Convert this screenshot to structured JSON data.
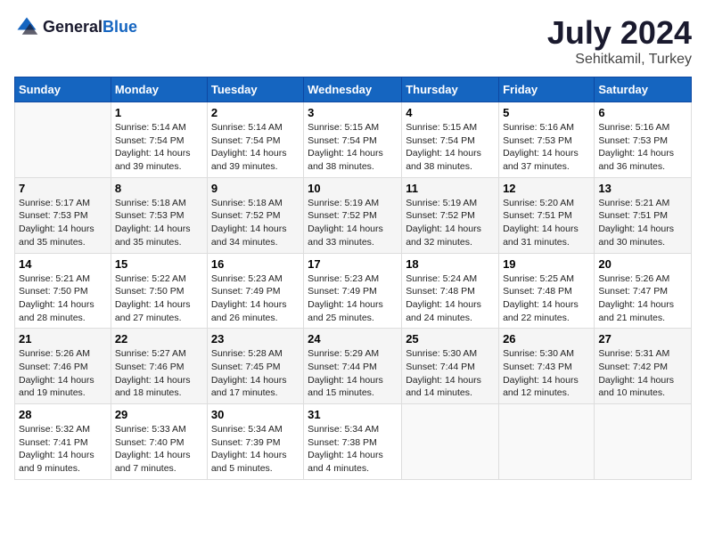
{
  "header": {
    "logo_general": "General",
    "logo_blue": "Blue",
    "month": "July 2024",
    "location": "Sehitkamil, Turkey"
  },
  "days_of_week": [
    "Sunday",
    "Monday",
    "Tuesday",
    "Wednesday",
    "Thursday",
    "Friday",
    "Saturday"
  ],
  "weeks": [
    [
      {
        "day": "",
        "sunrise": "",
        "sunset": "",
        "daylight": ""
      },
      {
        "day": "1",
        "sunrise": "Sunrise: 5:14 AM",
        "sunset": "Sunset: 7:54 PM",
        "daylight": "Daylight: 14 hours and 39 minutes."
      },
      {
        "day": "2",
        "sunrise": "Sunrise: 5:14 AM",
        "sunset": "Sunset: 7:54 PM",
        "daylight": "Daylight: 14 hours and 39 minutes."
      },
      {
        "day": "3",
        "sunrise": "Sunrise: 5:15 AM",
        "sunset": "Sunset: 7:54 PM",
        "daylight": "Daylight: 14 hours and 38 minutes."
      },
      {
        "day": "4",
        "sunrise": "Sunrise: 5:15 AM",
        "sunset": "Sunset: 7:54 PM",
        "daylight": "Daylight: 14 hours and 38 minutes."
      },
      {
        "day": "5",
        "sunrise": "Sunrise: 5:16 AM",
        "sunset": "Sunset: 7:53 PM",
        "daylight": "Daylight: 14 hours and 37 minutes."
      },
      {
        "day": "6",
        "sunrise": "Sunrise: 5:16 AM",
        "sunset": "Sunset: 7:53 PM",
        "daylight": "Daylight: 14 hours and 36 minutes."
      }
    ],
    [
      {
        "day": "7",
        "sunrise": "Sunrise: 5:17 AM",
        "sunset": "Sunset: 7:53 PM",
        "daylight": "Daylight: 14 hours and 35 minutes."
      },
      {
        "day": "8",
        "sunrise": "Sunrise: 5:18 AM",
        "sunset": "Sunset: 7:53 PM",
        "daylight": "Daylight: 14 hours and 35 minutes."
      },
      {
        "day": "9",
        "sunrise": "Sunrise: 5:18 AM",
        "sunset": "Sunset: 7:52 PM",
        "daylight": "Daylight: 14 hours and 34 minutes."
      },
      {
        "day": "10",
        "sunrise": "Sunrise: 5:19 AM",
        "sunset": "Sunset: 7:52 PM",
        "daylight": "Daylight: 14 hours and 33 minutes."
      },
      {
        "day": "11",
        "sunrise": "Sunrise: 5:19 AM",
        "sunset": "Sunset: 7:52 PM",
        "daylight": "Daylight: 14 hours and 32 minutes."
      },
      {
        "day": "12",
        "sunrise": "Sunrise: 5:20 AM",
        "sunset": "Sunset: 7:51 PM",
        "daylight": "Daylight: 14 hours and 31 minutes."
      },
      {
        "day": "13",
        "sunrise": "Sunrise: 5:21 AM",
        "sunset": "Sunset: 7:51 PM",
        "daylight": "Daylight: 14 hours and 30 minutes."
      }
    ],
    [
      {
        "day": "14",
        "sunrise": "Sunrise: 5:21 AM",
        "sunset": "Sunset: 7:50 PM",
        "daylight": "Daylight: 14 hours and 28 minutes."
      },
      {
        "day": "15",
        "sunrise": "Sunrise: 5:22 AM",
        "sunset": "Sunset: 7:50 PM",
        "daylight": "Daylight: 14 hours and 27 minutes."
      },
      {
        "day": "16",
        "sunrise": "Sunrise: 5:23 AM",
        "sunset": "Sunset: 7:49 PM",
        "daylight": "Daylight: 14 hours and 26 minutes."
      },
      {
        "day": "17",
        "sunrise": "Sunrise: 5:23 AM",
        "sunset": "Sunset: 7:49 PM",
        "daylight": "Daylight: 14 hours and 25 minutes."
      },
      {
        "day": "18",
        "sunrise": "Sunrise: 5:24 AM",
        "sunset": "Sunset: 7:48 PM",
        "daylight": "Daylight: 14 hours and 24 minutes."
      },
      {
        "day": "19",
        "sunrise": "Sunrise: 5:25 AM",
        "sunset": "Sunset: 7:48 PM",
        "daylight": "Daylight: 14 hours and 22 minutes."
      },
      {
        "day": "20",
        "sunrise": "Sunrise: 5:26 AM",
        "sunset": "Sunset: 7:47 PM",
        "daylight": "Daylight: 14 hours and 21 minutes."
      }
    ],
    [
      {
        "day": "21",
        "sunrise": "Sunrise: 5:26 AM",
        "sunset": "Sunset: 7:46 PM",
        "daylight": "Daylight: 14 hours and 19 minutes."
      },
      {
        "day": "22",
        "sunrise": "Sunrise: 5:27 AM",
        "sunset": "Sunset: 7:46 PM",
        "daylight": "Daylight: 14 hours and 18 minutes."
      },
      {
        "day": "23",
        "sunrise": "Sunrise: 5:28 AM",
        "sunset": "Sunset: 7:45 PM",
        "daylight": "Daylight: 14 hours and 17 minutes."
      },
      {
        "day": "24",
        "sunrise": "Sunrise: 5:29 AM",
        "sunset": "Sunset: 7:44 PM",
        "daylight": "Daylight: 14 hours and 15 minutes."
      },
      {
        "day": "25",
        "sunrise": "Sunrise: 5:30 AM",
        "sunset": "Sunset: 7:44 PM",
        "daylight": "Daylight: 14 hours and 14 minutes."
      },
      {
        "day": "26",
        "sunrise": "Sunrise: 5:30 AM",
        "sunset": "Sunset: 7:43 PM",
        "daylight": "Daylight: 14 hours and 12 minutes."
      },
      {
        "day": "27",
        "sunrise": "Sunrise: 5:31 AM",
        "sunset": "Sunset: 7:42 PM",
        "daylight": "Daylight: 14 hours and 10 minutes."
      }
    ],
    [
      {
        "day": "28",
        "sunrise": "Sunrise: 5:32 AM",
        "sunset": "Sunset: 7:41 PM",
        "daylight": "Daylight: 14 hours and 9 minutes."
      },
      {
        "day": "29",
        "sunrise": "Sunrise: 5:33 AM",
        "sunset": "Sunset: 7:40 PM",
        "daylight": "Daylight: 14 hours and 7 minutes."
      },
      {
        "day": "30",
        "sunrise": "Sunrise: 5:34 AM",
        "sunset": "Sunset: 7:39 PM",
        "daylight": "Daylight: 14 hours and 5 minutes."
      },
      {
        "day": "31",
        "sunrise": "Sunrise: 5:34 AM",
        "sunset": "Sunset: 7:38 PM",
        "daylight": "Daylight: 14 hours and 4 minutes."
      },
      {
        "day": "",
        "sunrise": "",
        "sunset": "",
        "daylight": ""
      },
      {
        "day": "",
        "sunrise": "",
        "sunset": "",
        "daylight": ""
      },
      {
        "day": "",
        "sunrise": "",
        "sunset": "",
        "daylight": ""
      }
    ]
  ]
}
